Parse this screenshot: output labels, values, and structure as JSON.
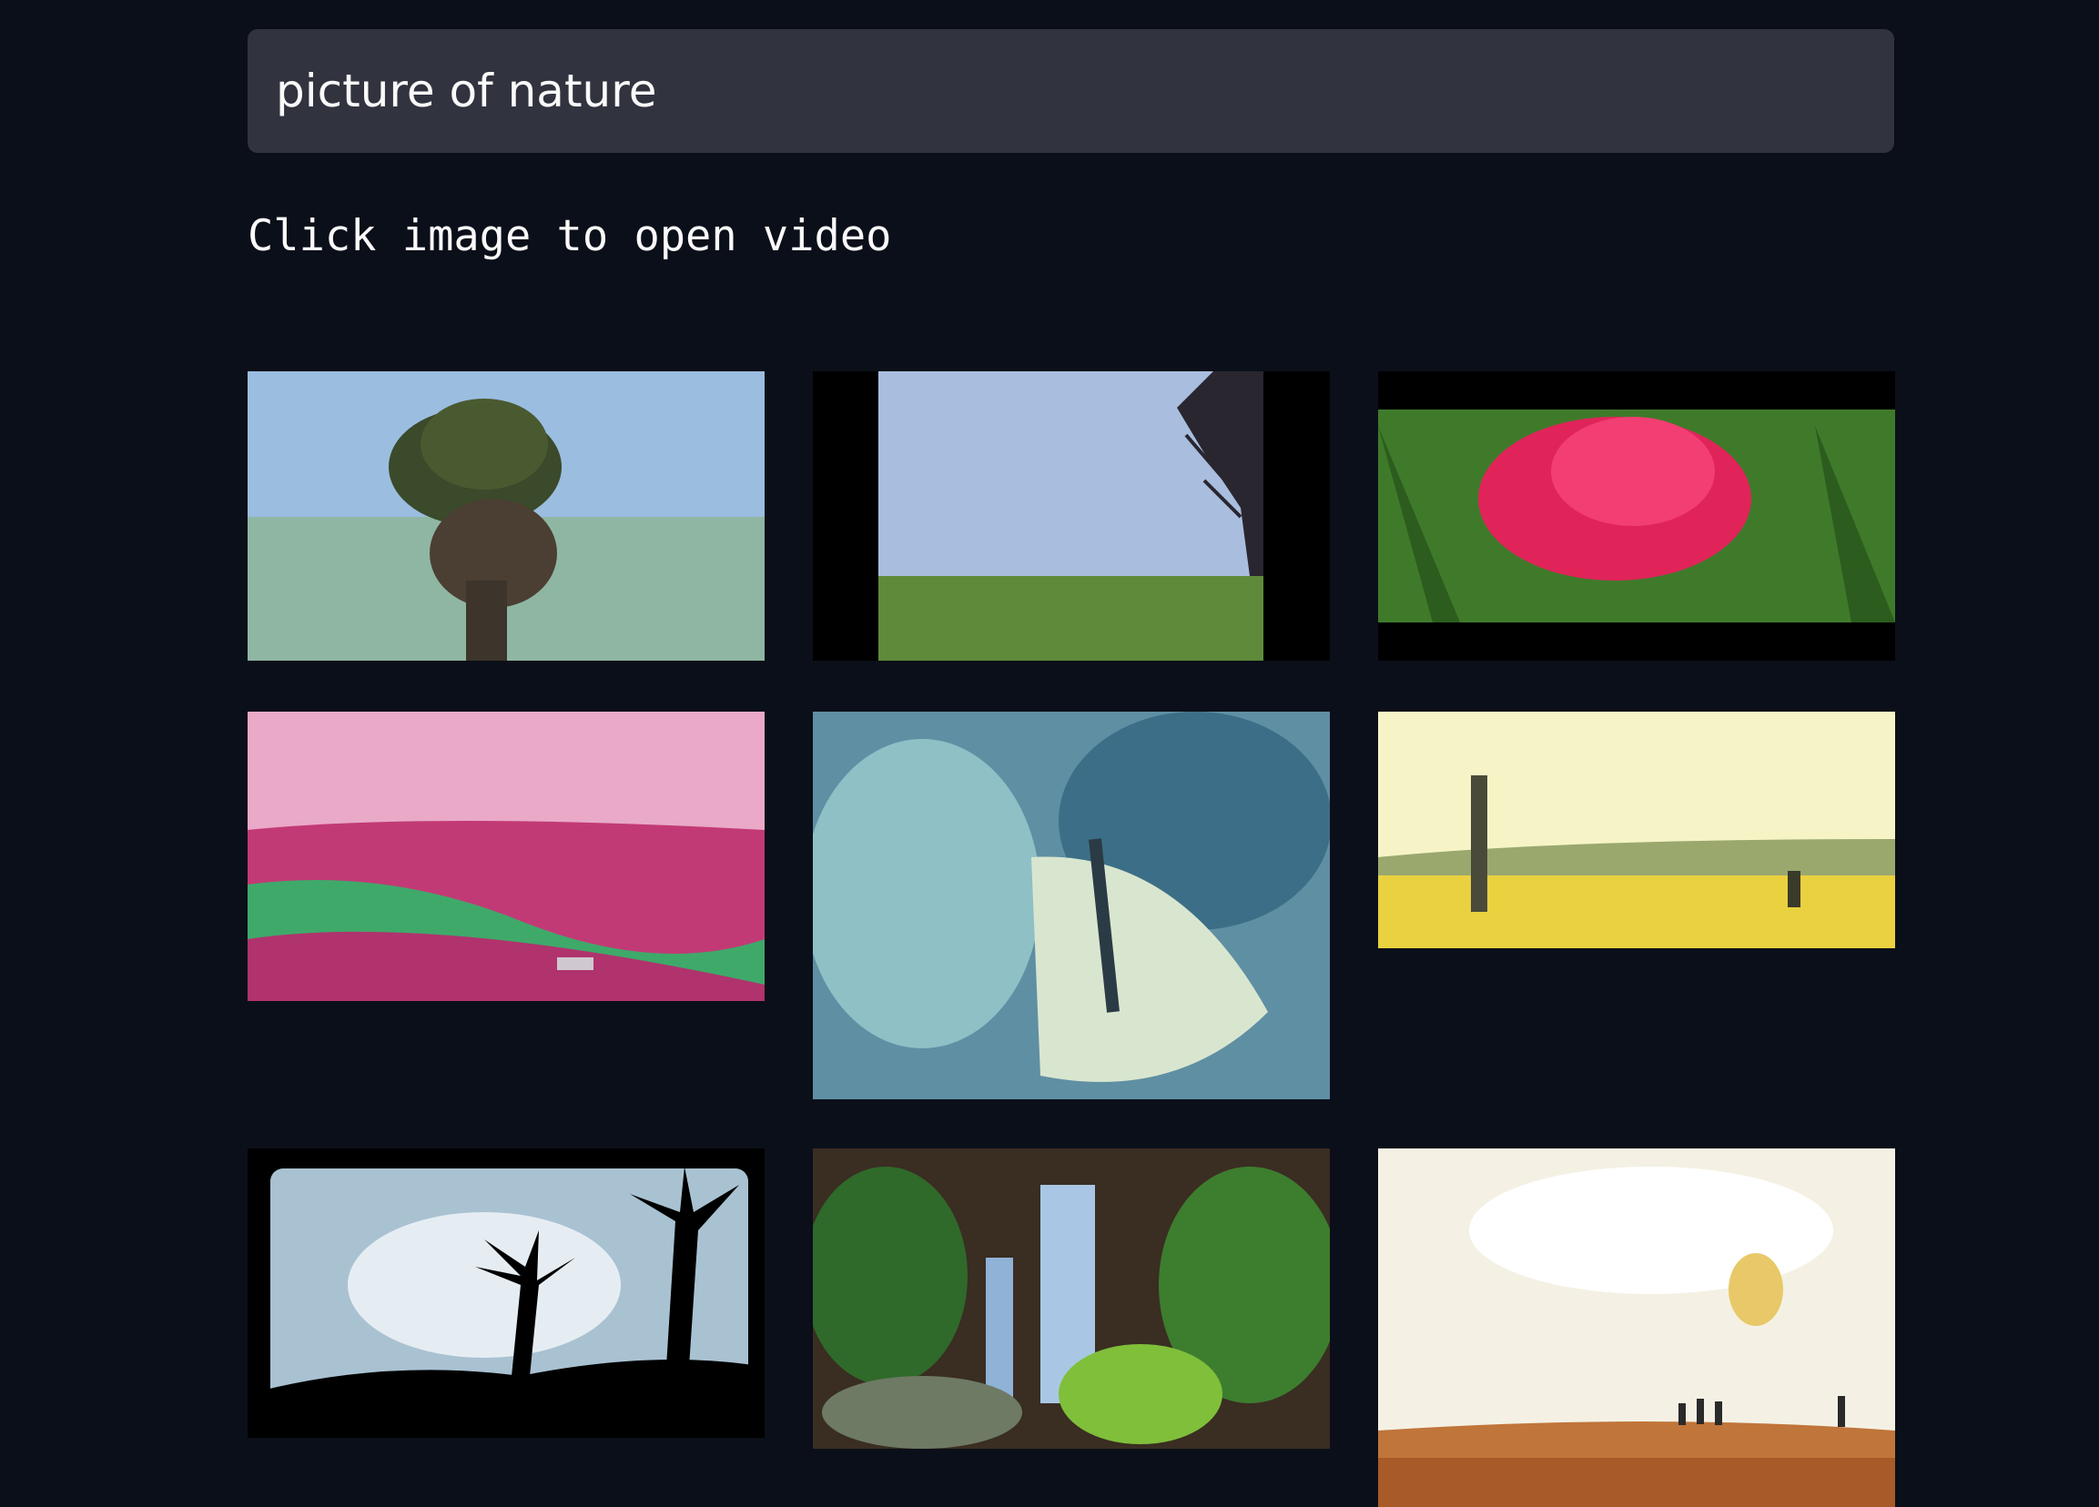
{
  "search": {
    "value": "picture of nature"
  },
  "caption": "Click image to open video",
  "gallery": [
    {
      "scene": "mushroom-tree-over-sea"
    },
    {
      "scene": "field-with-bare-tree"
    },
    {
      "scene": "pink-tulip"
    },
    {
      "scene": "pink-green-hills-car"
    },
    {
      "scene": "butterfly-on-leaf"
    },
    {
      "scene": "scarecrow-sunflower-field"
    },
    {
      "scene": "palm-silhouettes"
    },
    {
      "scene": "waterfall-garden"
    },
    {
      "scene": "painted-field-figures"
    }
  ]
}
